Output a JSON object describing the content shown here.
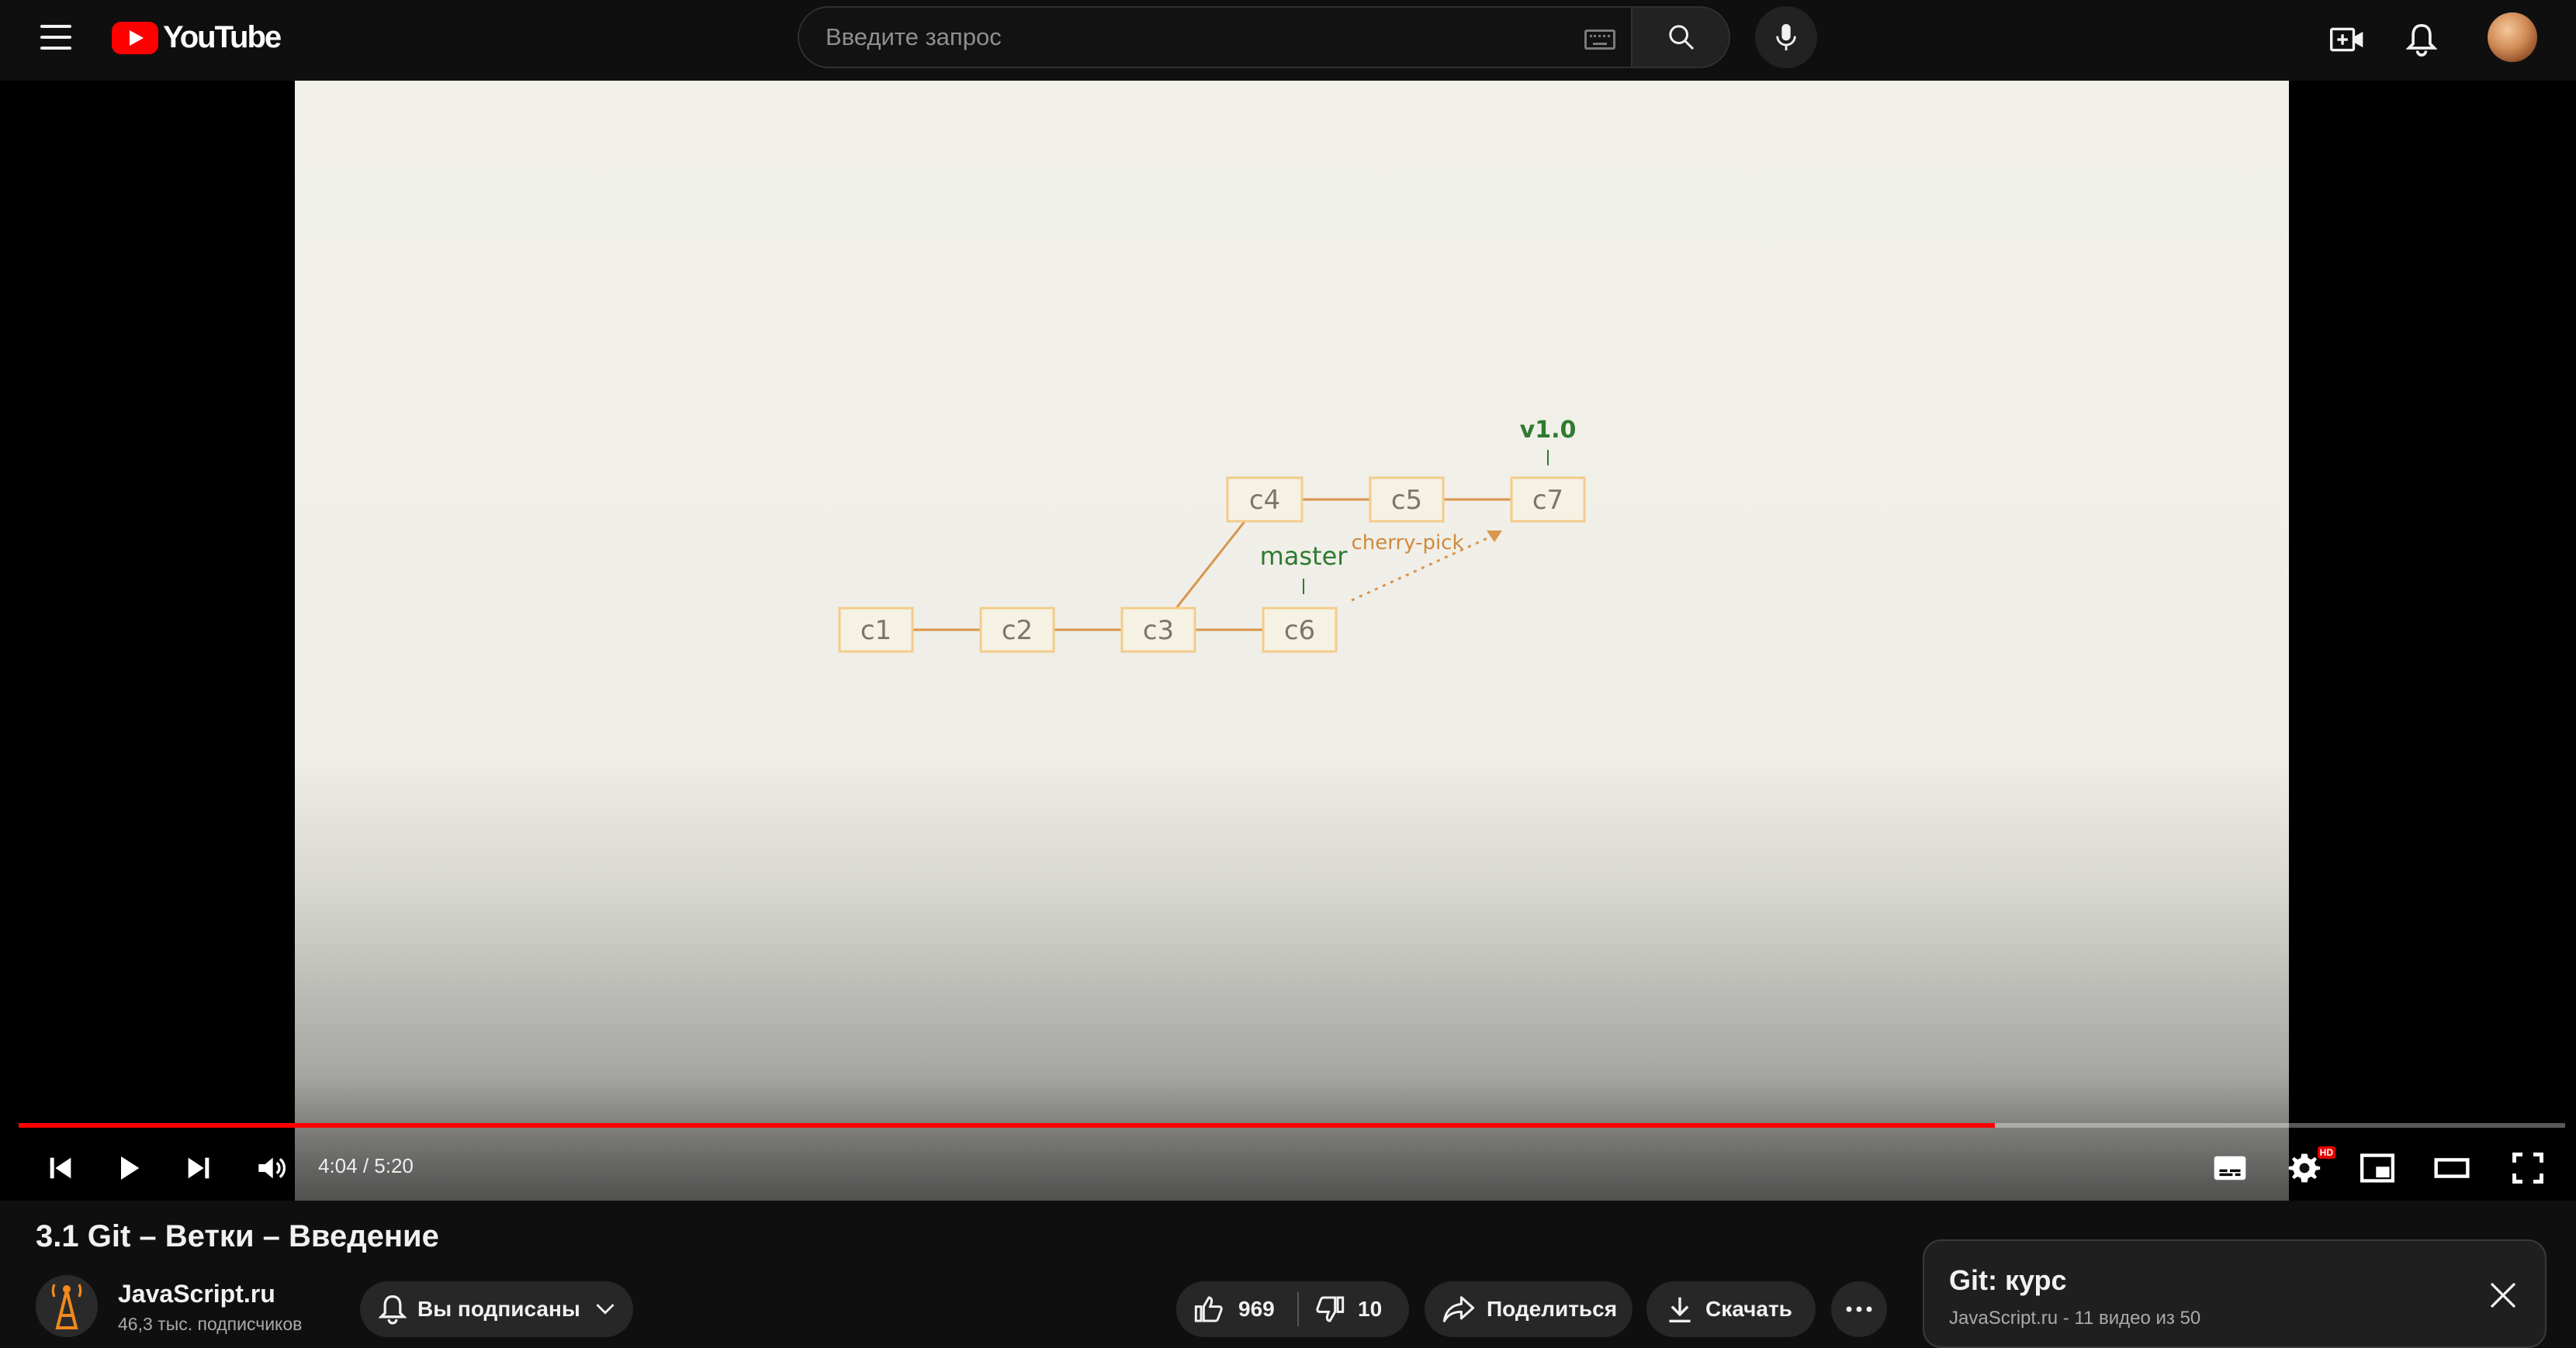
{
  "header": {
    "logo_text": "YouTube",
    "search_placeholder": "Введите запрос"
  },
  "video": {
    "diagram": {
      "nodes": [
        "c1",
        "c2",
        "c3",
        "c4",
        "c5",
        "c6",
        "c7"
      ],
      "tag_v10": "v1.0",
      "tag_master": "master",
      "arrow_label": "cherry-pick"
    },
    "player": {
      "time": "4:04 / 5:20",
      "progress_fraction": 0.776,
      "hd_badge": "HD"
    }
  },
  "info": {
    "title": "3.1 Git – Ветки – Введение",
    "channel_name": "JavaScript.ru",
    "subscribers": "46,3 тыс. подписчиков",
    "subscribed_label": "Вы подписаны",
    "likes": "969",
    "dislikes": "10",
    "share_label": "Поделиться",
    "download_label": "Скачать"
  },
  "playlist": {
    "title": "Git: курс",
    "meta": "JavaScript.ru - 11 видео из 50"
  },
  "colors": {
    "brand_red": "#ff0000",
    "node_border": "#f3cc8a",
    "edge": "#d9954a",
    "tag_green": "#2f7a2f"
  }
}
